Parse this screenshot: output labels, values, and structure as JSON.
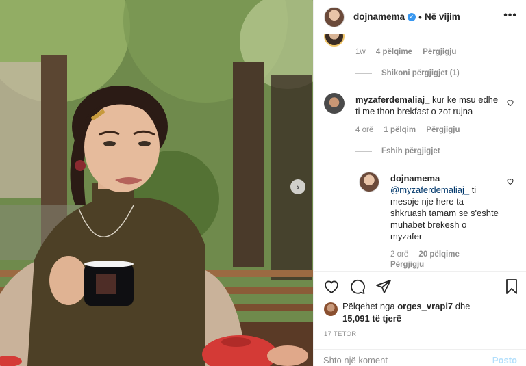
{
  "post": {
    "author": "dojnamema",
    "verified": true,
    "separator": "•",
    "follow_label": "Në vijim",
    "more_icon": "more-horizontal-icon",
    "next_icon": "chevron-right-icon"
  },
  "comments": {
    "first": {
      "time": "1w",
      "likes": "4 pëlqime",
      "reply": "Përgjigju"
    },
    "view_replies": "Shikoni përgjigjet (1)",
    "second": {
      "username": "myzaferdemaliaj_",
      "text": "kur ke msu edhe ti me thon brekfast o zot rujna",
      "time": "4 orë",
      "likes": "1 pëlqim",
      "reply": "Përgjigju"
    },
    "hide_replies": "Fshih përgjigjet",
    "reply_item": {
      "username": "dojnamema",
      "mention": "@myzaferdemaliaj_",
      "text": " ti mesoje nje here ta shkruash tamam se s'eshte muhabet brekesh o myzafer",
      "time": "2 orë",
      "likes": "20 pëlqime",
      "reply": "Përgjigju"
    }
  },
  "actions": {
    "liked_prefix": "Pëlqehet nga ",
    "liked_user": "orges_vrapi7",
    "liked_suffix": " dhe",
    "liked_others": "15,091 të tjerë",
    "date": "17 TETOR"
  },
  "comment_box": {
    "placeholder": "Shto një koment",
    "post_label": "Posto"
  },
  "colors": {
    "verified": "#3897f0",
    "mention": "#00376b",
    "post_disabled": "#b2dffc",
    "muted": "#8e8e8e"
  }
}
